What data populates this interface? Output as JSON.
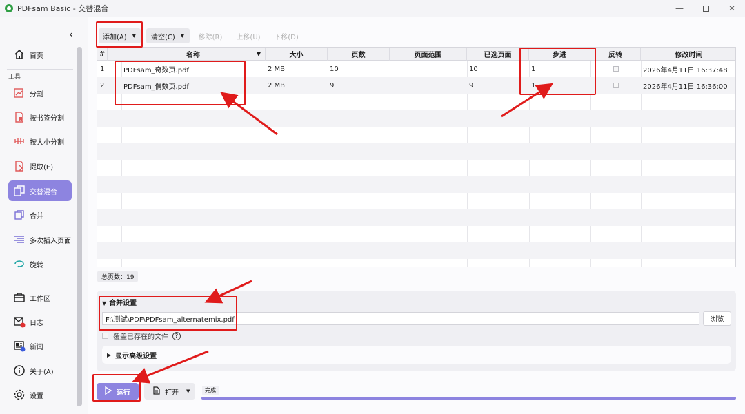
{
  "window": {
    "title": "PDFsam Basic - 交替混合",
    "controls": [
      "minimize",
      "maximize",
      "close"
    ]
  },
  "sidebar": {
    "collapse_icon": "chevron-left-icon",
    "tools_label": "工具",
    "items": [
      {
        "label": "首页",
        "icon": "home-icon"
      },
      {
        "label": "分割",
        "icon": "split-icon"
      },
      {
        "label": "按书签分割",
        "icon": "bookmark-split-icon"
      },
      {
        "label": "按大小分割",
        "icon": "size-split-icon"
      },
      {
        "label": "提取(E)",
        "icon": "extract-icon"
      },
      {
        "label": "交替混合",
        "icon": "alternate-mix-icon",
        "active": true
      },
      {
        "label": "合并",
        "icon": "merge-icon"
      },
      {
        "label": "多次插入页面",
        "icon": "insert-icon"
      },
      {
        "label": "旋转",
        "icon": "rotate-icon"
      },
      {
        "label": "工作区",
        "icon": "briefcase-icon"
      },
      {
        "label": "日志",
        "icon": "log-icon"
      },
      {
        "label": "新闻",
        "icon": "news-icon"
      },
      {
        "label": "关于(A)",
        "icon": "info-icon"
      },
      {
        "label": "设置",
        "icon": "gear-icon"
      }
    ]
  },
  "toolbar": {
    "add": "添加(A)",
    "clear": "清空(C)",
    "remove": "移除(R)",
    "move_up": "上移(U)",
    "move_down": "下移(D)"
  },
  "table": {
    "headers": [
      "#",
      "名称",
      "大小",
      "页数",
      "页面范围",
      "已选页面",
      "步进",
      "反转",
      "修改时间"
    ],
    "rows": [
      {
        "num": "1",
        "name": "PDFsam_奇数页.pdf",
        "size": "2 MB",
        "pages": "10",
        "range": "",
        "selected": "10",
        "step": "1",
        "reverse": false,
        "modified": "2026年4月11日 16:37:48"
      },
      {
        "num": "2",
        "name": "PDFsam_偶数页.pdf",
        "size": "2 MB",
        "pages": "9",
        "range": "",
        "selected": "9",
        "step": "1",
        "reverse": false,
        "modified": "2026年4月11日 16:36:00"
      }
    ]
  },
  "summary": {
    "total_pages": "总页数：19"
  },
  "merge_settings": {
    "title": "合并设置",
    "output_path": "F:\\测试\\PDF\\PDFsam_alternatemix.pdf",
    "browse": "浏览",
    "overwrite_label": "覆盖已存在的文件",
    "advanced": "显示高级设置"
  },
  "footer": {
    "run": "运行",
    "open": "打开",
    "status": "完成",
    "progress": 1.0
  },
  "colors": {
    "accent": "#8d84e0",
    "annotation": "#e01b1b"
  }
}
